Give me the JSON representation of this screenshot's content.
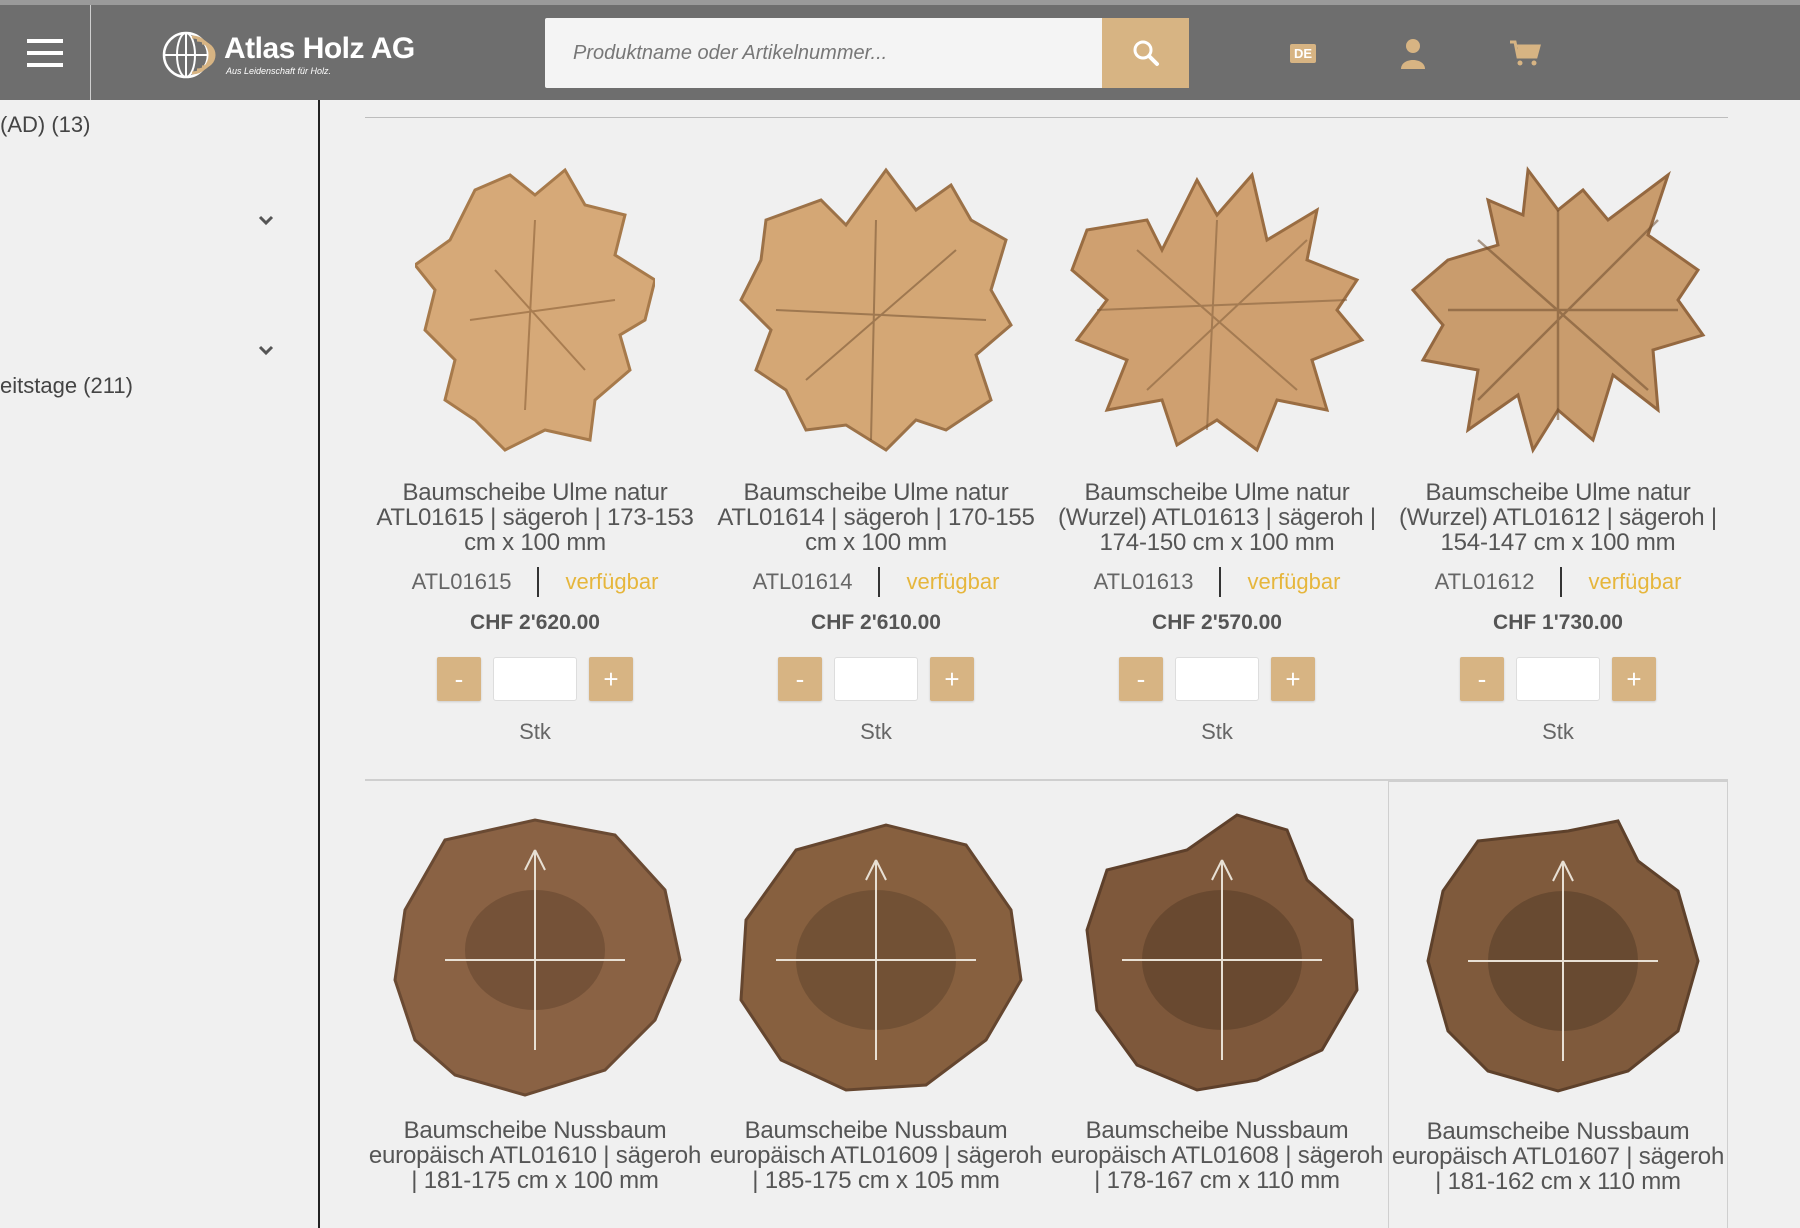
{
  "header": {
    "brand_name": "Atlas Holz AG",
    "brand_tagline": "Aus Leidenschaft für Holz.",
    "search_placeholder": "Produktname oder Artikelnummer...",
    "language": "DE",
    "accent_color": "#d7b483",
    "icons": [
      "menu-icon",
      "search-icon",
      "user-icon",
      "cart-icon"
    ]
  },
  "sidebar": {
    "item1": "(AD) (13)",
    "item2": "eitstage (211)"
  },
  "products_row1": [
    {
      "name": "Baumscheibe Ulme natur ATL01615 | sägeroh | 173-153 cm x 100 mm",
      "sku": "ATL01615",
      "status": "verfügbar",
      "price": "CHF 2'620.00",
      "minus": "-",
      "plus": "+",
      "unit": "Stk"
    },
    {
      "name": "Baumscheibe Ulme natur ATL01614 | sägeroh | 170-155 cm x 100 mm",
      "sku": "ATL01614",
      "status": "verfügbar",
      "price": "CHF 2'610.00",
      "minus": "-",
      "plus": "+",
      "unit": "Stk"
    },
    {
      "name": "Baumscheibe Ulme natur (Wurzel) ATL01613 | sägeroh | 174-150 cm x 100 mm",
      "sku": "ATL01613",
      "status": "verfügbar",
      "price": "CHF 2'570.00",
      "minus": "-",
      "plus": "+",
      "unit": "Stk"
    },
    {
      "name": "Baumscheibe Ulme natur (Wurzel) ATL01612 | sägeroh | 154-147 cm x 100 mm",
      "sku": "ATL01612",
      "status": "verfügbar",
      "price": "CHF 1'730.00",
      "minus": "-",
      "plus": "+",
      "unit": "Stk"
    }
  ],
  "products_row2": [
    {
      "name": "Baumscheibe Nussbaum europäisch ATL01610 | sägeroh | 181-175 cm x 100 mm"
    },
    {
      "name": "Baumscheibe Nussbaum europäisch ATL01609 | sägeroh | 185-175 cm x 105 mm"
    },
    {
      "name": "Baumscheibe Nussbaum europäisch ATL01608 | sägeroh | 178-167 cm x 110 mm"
    },
    {
      "name": "Baumscheibe Nussbaum europäisch ATL01607 | sägeroh | 181-162 cm x 110 mm"
    }
  ]
}
